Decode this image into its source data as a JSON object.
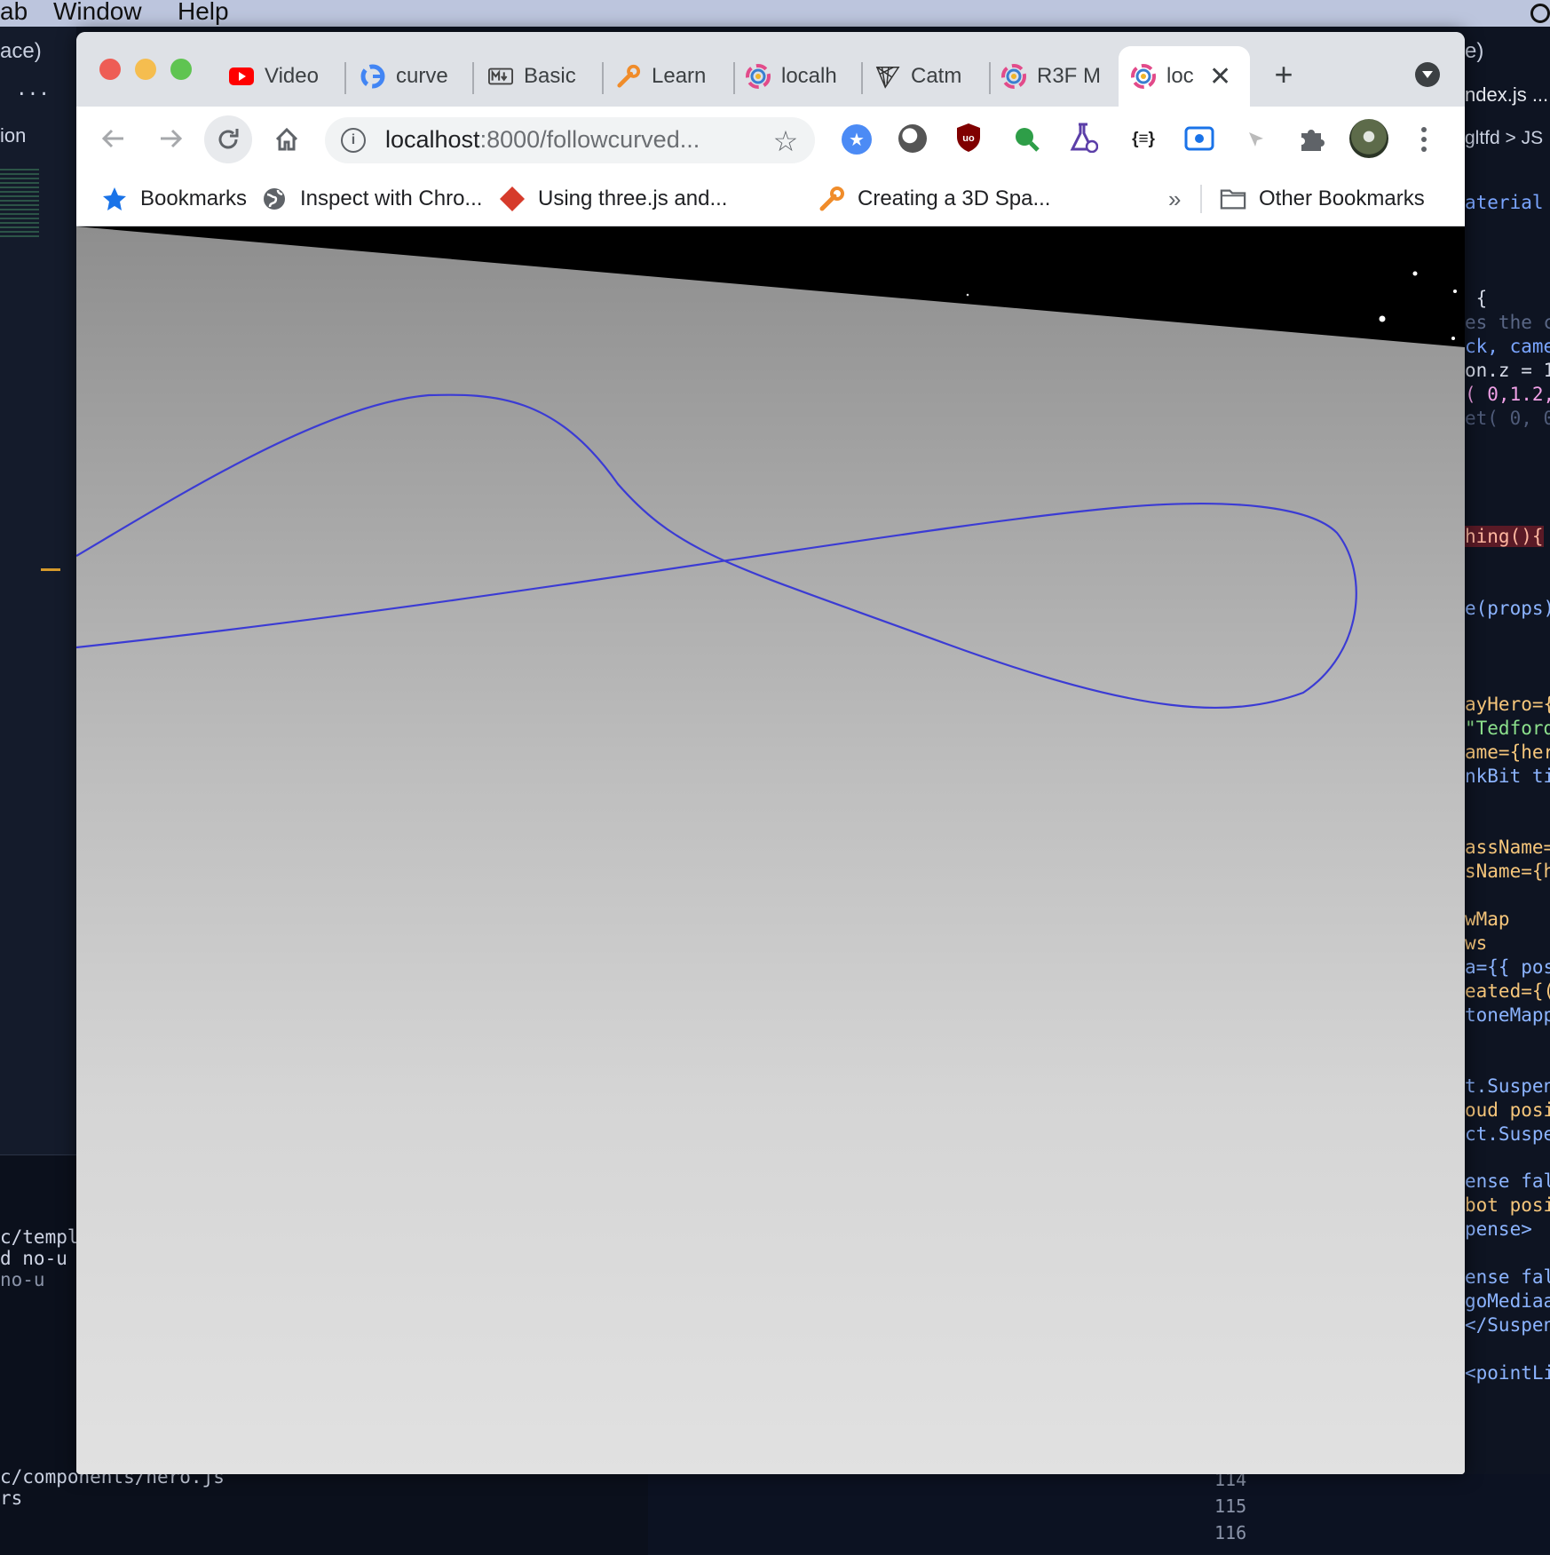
{
  "menubar": {
    "items": [
      "ab",
      "Window",
      "Help"
    ]
  },
  "editor": {
    "left_texts": [
      "ace)",
      "...",
      "ion"
    ],
    "terminal_lines": [
      "c/templ",
      "d  no-u",
      "   no-u",
      "c/components/hero.js",
      "rs"
    ],
    "right_title": "e)",
    "right_file": "ndex.js ...",
    "right_breadcrumb": "gltfd > JS",
    "code_lines": [
      {
        "text": "aterial",
        "color": "#7aa5ff"
      },
      {
        "text": " {",
        "color": "#d6dbe8"
      },
      {
        "text": "es the c",
        "color": "#5a6786"
      },
      {
        "text": "ck, came",
        "color": "#7aa5ff"
      },
      {
        "text": "on.z = 1",
        "color": "#d6dbe8"
      },
      {
        "text": "( 0,1.2,",
        "color": "#f0a0e6"
      },
      {
        "text": "et( 0, 0",
        "color": "#4f5b79"
      },
      {
        "text": "hing(){",
        "color": "#ffb7a0"
      },
      {
        "text": "e(props)",
        "color": "#8cb4ff"
      },
      {
        "text": "ayHero={",
        "color": "#f6c67b"
      },
      {
        "text": "\"Tedford",
        "color": "#8ce08c"
      },
      {
        "text": "ame={her",
        "color": "#f6c67b"
      },
      {
        "text": "nkBit ti",
        "color": "#8cb4ff"
      },
      {
        "text": "assName=",
        "color": "#f6c67b"
      },
      {
        "text": "sName={h",
        "color": "#f6c67b"
      },
      {
        "text": "wMap",
        "color": "#f6c67b"
      },
      {
        "text": "ws",
        "color": "#f6c67b"
      },
      {
        "text": "a={{ pos",
        "color": "#8cb4ff"
      },
      {
        "text": "eated={({",
        "color": "#f6c67b"
      },
      {
        "text": "toneMapp",
        "color": "#8cb4ff"
      },
      {
        "text": "t.Suspen",
        "color": "#8cb4ff"
      },
      {
        "text": "oud posi",
        "color": "#f6c67b"
      },
      {
        "text": "ct.Suspe",
        "color": "#8cb4ff"
      },
      {
        "text": "ense fal",
        "color": "#8cb4ff"
      },
      {
        "text": "bot posi",
        "color": "#f6c67b"
      },
      {
        "text": "pense>",
        "color": "#8cb4ff"
      },
      {
        "text": "ense fal",
        "color": "#8cb4ff"
      },
      {
        "text": "goMediaa",
        "color": "#8cb4ff"
      },
      {
        "text": "</Suspense>",
        "color": "#8cb4ff"
      },
      {
        "text": "<pointLight",
        "color": "#8cb4ff"
      }
    ],
    "line_numbers": [
      "114",
      "115",
      "116"
    ]
  },
  "browser": {
    "tabs": [
      {
        "label": "Video",
        "icon": "youtube-icon"
      },
      {
        "label": "curve",
        "icon": "google-icon"
      },
      {
        "label": "Basic",
        "icon": "markdown-icon"
      },
      {
        "label": "Learn",
        "icon": "wrench-icon"
      },
      {
        "label": "localh",
        "icon": "color-wheel-icon"
      },
      {
        "label": "Catm",
        "icon": "triangle-mesh-icon"
      },
      {
        "label": "R3F M",
        "icon": "color-wheel-icon"
      },
      {
        "label": "loc",
        "icon": "color-wheel-icon",
        "active": true
      }
    ],
    "url": {
      "host": "localhost",
      "rest": ":8000/followcurved..."
    },
    "bookmarks": [
      {
        "label": "Bookmarks",
        "icon": "star-icon"
      },
      {
        "label": "Inspect with Chro...",
        "icon": "globe-icon"
      },
      {
        "label": "Using three.js and...",
        "icon": "diamond-icon"
      },
      {
        "label": "Creating a 3D Spa...",
        "icon": "wrench-icon"
      }
    ],
    "overflow_label": "»",
    "other_bookmarks": "Other Bookmarks",
    "extension_label": "{≡}",
    "colors": {
      "curve": "#3b3bd4",
      "accent_blue": "#1a73e8"
    }
  }
}
